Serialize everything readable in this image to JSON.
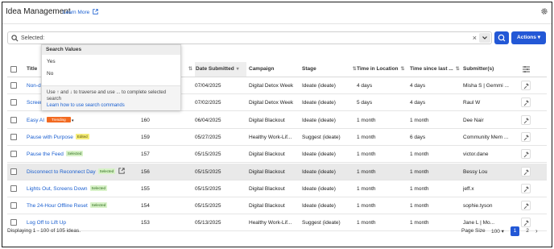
{
  "header": {
    "title": "Idea Management",
    "learn_more": "Learn More"
  },
  "search": {
    "selected_label": "Selected:",
    "clear": "×",
    "actions_label": "Actions ▾"
  },
  "popup": {
    "heading": "Search Values",
    "options": [
      "Yes",
      "No"
    ],
    "help_text": "Use ↑ and ↓ to traverse and use ... to complete selected search",
    "help_link": "Learn how to use search commands"
  },
  "table": {
    "columns": [
      "Title",
      "Date Submitted",
      "Campaign",
      "Stage",
      "Time in Location",
      "Time since last ...",
      "Submitter(s)"
    ],
    "rows": [
      {
        "title": "Non-d",
        "badge": "",
        "id": "",
        "date": "07/04/2025",
        "campaign": "Digital Detox Week",
        "stage": "Ideate (ideate)",
        "tloc": "4 days",
        "tlast": "4 days",
        "sub": "Misha S | Gemmi ..."
      },
      {
        "title": "Screen",
        "badge": "",
        "id": "",
        "date": "07/02/2025",
        "campaign": "Digital Detox Week",
        "stage": "Ideate (ideate)",
        "tloc": "5 days",
        "tlast": "4 days",
        "sub": "Raul W"
      },
      {
        "title": "Easy AI",
        "badge": "Trending",
        "badge_type": "trending",
        "id": "160",
        "date": "06/04/2025",
        "campaign": "Digital Blackout",
        "stage": "Ideate (ideate)",
        "tloc": "1 month",
        "tlast": "1 month",
        "sub": "Dee Nair"
      },
      {
        "title": "Pause with Purpose",
        "badge": "Edited",
        "badge_type": "edited",
        "id": "159",
        "date": "05/27/2025",
        "campaign": "Healthy Work-Lif...",
        "stage": "Suggest (ideate)",
        "tloc": "1 month",
        "tlast": "6 days",
        "sub": "Community Mem ..."
      },
      {
        "title": "Pause the Feed",
        "badge": "Selected",
        "badge_type": "selected",
        "id": "157",
        "date": "05/15/2025",
        "campaign": "Digital Blackout",
        "stage": "Ideate (ideate)",
        "tloc": "1 month",
        "tlast": "1 month",
        "sub": "victor.dane"
      },
      {
        "title": "Disconnect to Reconnect Day",
        "badge": "Selected",
        "badge_type": "selected",
        "id": "156",
        "date": "05/15/2025",
        "campaign": "Digital Blackout",
        "stage": "Ideate (ideate)",
        "tloc": "1 month",
        "tlast": "1 month",
        "sub": "Bessy Lou",
        "highlight": true
      },
      {
        "title": "Lights Out, Screens Down",
        "badge": "Selected",
        "badge_type": "selected",
        "id": "155",
        "date": "05/15/2025",
        "campaign": "Digital Blackout",
        "stage": "Ideate (ideate)",
        "tloc": "1 month",
        "tlast": "1 month",
        "sub": "jeff.x"
      },
      {
        "title": "The 24-Hour Offline Reset",
        "badge": "Selected",
        "badge_type": "selected",
        "id": "154",
        "date": "05/15/2025",
        "campaign": "Digital Blackout",
        "stage": "Ideate (ideate)",
        "tloc": "1 month",
        "tlast": "1 month",
        "sub": "sophie.tyson"
      },
      {
        "title": "Log Off to Lift Up",
        "badge": "",
        "id": "153",
        "date": "05/13/2025",
        "campaign": "Healthy Work-Lif...",
        "stage": "Suggest (ideate)",
        "tloc": "1 month",
        "tlast": "1 month",
        "sub": "Jane L | Mo..."
      }
    ]
  },
  "footer": {
    "displaying": "Displaying 1 - 100 of 105 ideas.",
    "page_size_label": "Page Size",
    "page_size_value": "100 ▾",
    "page1": "1",
    "page2": "2",
    "next": "›"
  },
  "colors": {
    "accent": "#2358d6",
    "link": "#1a5fd0",
    "trending": "#f26a21",
    "edited": "#f4ec7a",
    "selected": "#d8f2c8"
  }
}
